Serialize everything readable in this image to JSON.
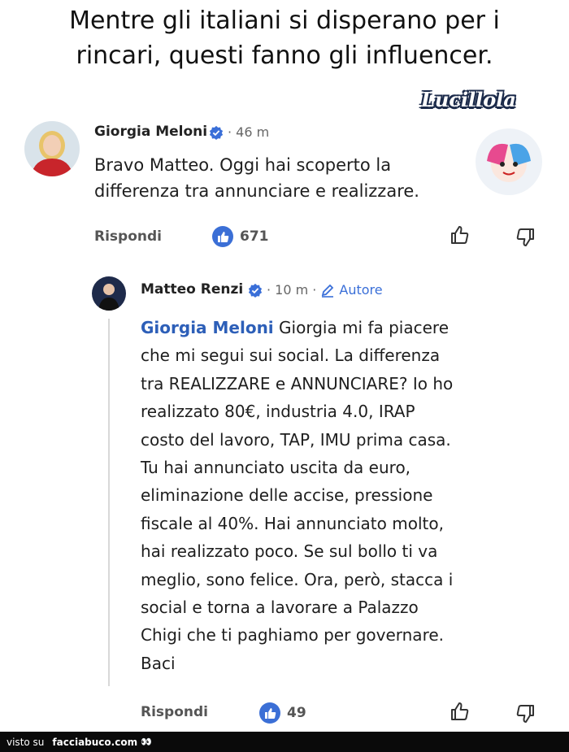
{
  "caption": {
    "line1": "Mentre gli italiani si disperano per i",
    "line2": "rincari, questi fanno gli influencer."
  },
  "signature": "Lucillola",
  "comment": {
    "author": "Giorgia Meloni",
    "time": "· 46 m",
    "text_line1": "Bravo Matteo. Oggi hai scoperto la",
    "text_line2": "differenza tra annunciare e realizzare.",
    "reply_label": "Rispondi",
    "likes": "671"
  },
  "reply": {
    "author": "Matteo Renzi",
    "time": "· 10 m ·",
    "badge": "Autore",
    "mention": "Giorgia Meloni",
    "lines": [
      " Giorgia mi fa piacere",
      "che mi segui sui social. La differenza",
      "tra REALIZZARE e ANNUNCIARE? Io ho",
      "realizzato 80€, industria 4.0, IRAP",
      "costo del lavoro, TAP, IMU prima casa.",
      "Tu hai annunciato uscita da euro,",
      "eliminazione delle accise, pressione",
      "fiscale al 40%. Hai annunciato molto,",
      "hai realizzato poco. Se sul bollo ti va",
      "meglio, sono felice. Ora, però, stacca i",
      "social e torna a lavorare a Palazzo",
      "Chigi che ti paghiamo per governare.",
      "Baci"
    ],
    "reply_label": "Rispondi",
    "likes": "49"
  },
  "footer": {
    "prefix": "visto su",
    "site": "facciabuco.com",
    "eyes": "👀"
  },
  "colors": {
    "like_blue": "#3b6fd6",
    "mention_blue": "#2d5fb8",
    "verified_blue": "#3a6fd8"
  }
}
